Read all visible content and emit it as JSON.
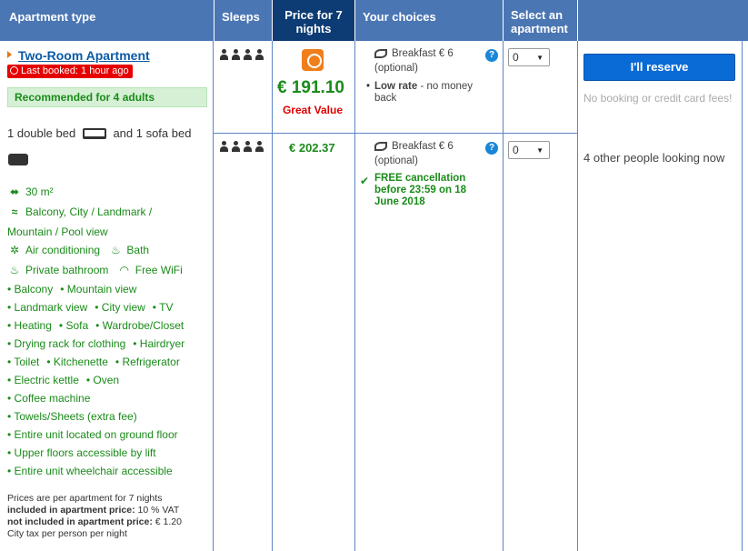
{
  "headers": {
    "apartment_type": "Apartment type",
    "sleeps": "Sleeps",
    "price": "Price for 7 nights",
    "choices": "Your choices",
    "select": "Select an apartment"
  },
  "room": {
    "title": "Two-Room Apartment",
    "last_booked": "Last booked: 1 hour ago",
    "recommended": "Recommended for 4 adults",
    "beds_part1": "1 double bed",
    "beds_part2": "and 1 sofa bed",
    "size": "30 m²",
    "view_line1": "Balcony, City / Landmark /",
    "view_line2": "Mountain / Pool view",
    "air": "Air conditioning",
    "bath": "Bath",
    "private_bath": "Private bathroom",
    "wifi": "Free WiFi",
    "bullet_rows": [
      [
        "Balcony",
        "Mountain view"
      ],
      [
        "Landmark view",
        "City view",
        "TV"
      ],
      [
        "Heating",
        "Sofa",
        "Wardrobe/Closet"
      ],
      [
        "Drying rack for clothing",
        "Hairdryer"
      ],
      [
        "Toilet",
        "Kitchenette",
        "Refrigerator"
      ],
      [
        "Electric kettle",
        "Oven"
      ],
      [
        "Coffee machine"
      ],
      [
        "Towels/Sheets (extra fee)"
      ],
      [
        "Entire unit located on ground floor"
      ],
      [
        "Upper floors accessible by lift"
      ],
      [
        "Entire unit wheelchair accessible"
      ]
    ],
    "note_line1": "Prices are per apartment for 7 nights",
    "note_inc_label": "included in apartment price:",
    "note_inc_value": "10 % VAT",
    "note_notinc_label": "not included in apartment price:",
    "note_notinc_value": "€ 1.20",
    "note_line4": "City tax per person per night"
  },
  "options": [
    {
      "price": "€ 191.10",
      "badge": "Great Value",
      "breakfast": "Breakfast € 6",
      "breakfast_note": "(optional)",
      "rate_label": "Low rate",
      "rate_note": "- no money back",
      "qty": "0"
    },
    {
      "price": "€ 202.37",
      "breakfast": "Breakfast € 6",
      "breakfast_note": "(optional)",
      "cancel": "FREE cancellation before 23:59 on 18 June 2018",
      "qty": "0"
    }
  ],
  "reserve": {
    "button": "I'll reserve",
    "no_fees": "No booking or credit card fees!",
    "looking": "4 other people looking now"
  },
  "help": "?",
  "colors": {
    "header": "#4b76b4",
    "price_header": "#0d3b73",
    "green": "#1a8b1a",
    "button": "#0b6bd6",
    "last_booked": "#e60000"
  }
}
